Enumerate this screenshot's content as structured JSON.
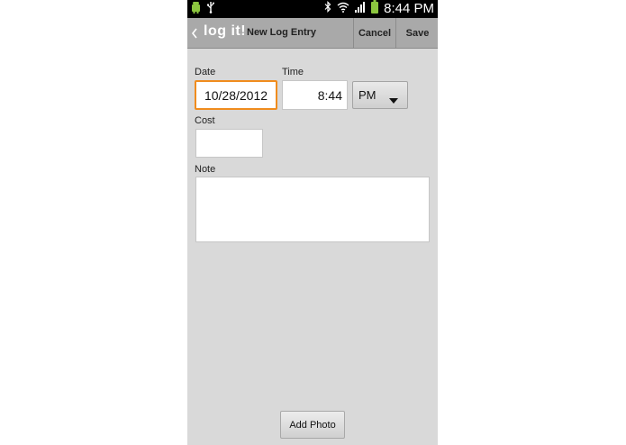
{
  "status_bar": {
    "time": "8:44 PM",
    "icons": [
      "android-icon",
      "usb-icon",
      "bluetooth-icon",
      "wifi-icon",
      "signal-icon",
      "battery-icon"
    ]
  },
  "action_bar": {
    "logo": "log it!",
    "title": "New Log Entry",
    "cancel_label": "Cancel",
    "save_label": "Save"
  },
  "form": {
    "date_label": "Date",
    "date_value": "10/28/2012",
    "time_label": "Time",
    "time_value": "8:44",
    "ampm_value": "PM",
    "cost_label": "Cost",
    "cost_value": "",
    "note_label": "Note",
    "note_value": ""
  },
  "add_photo_label": "Add Photo",
  "colors": {
    "background": "#d9d9d9",
    "action_bar": "#a9a9a9",
    "focus_accent": "#f08c1e",
    "status_icon_green": "#8cc63f"
  }
}
